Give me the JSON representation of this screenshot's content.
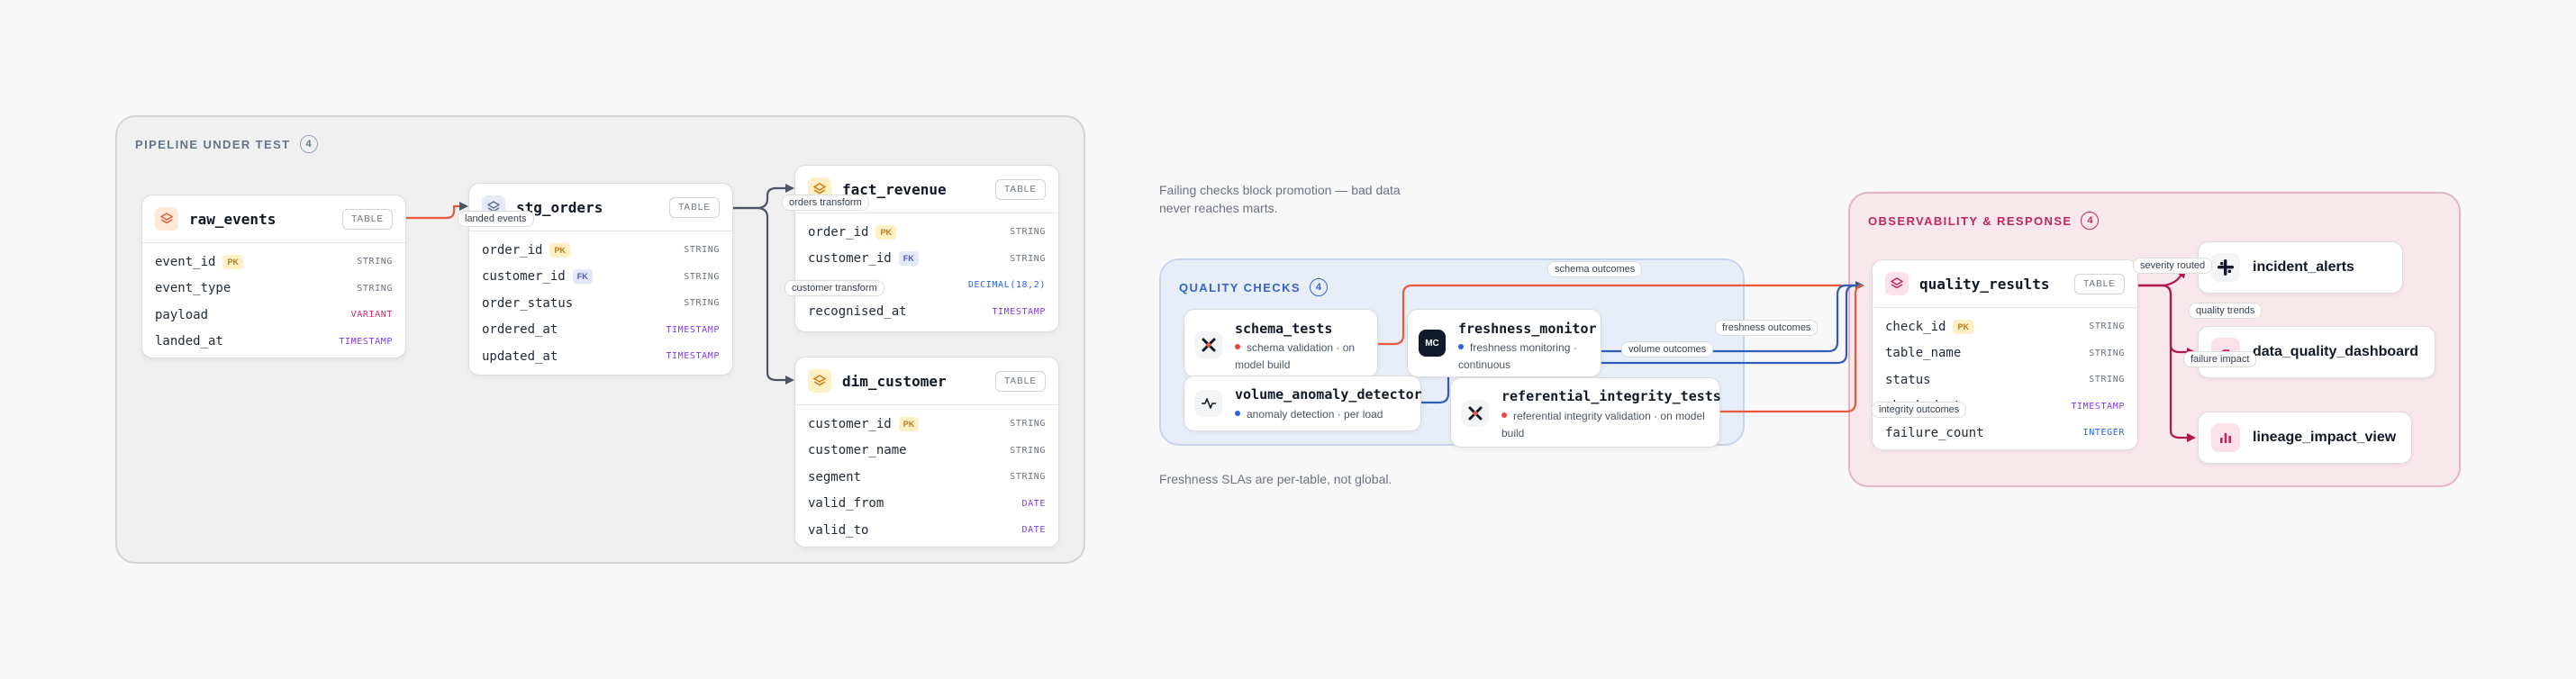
{
  "groups": {
    "pipeline": {
      "title": "PIPELINE UNDER TEST",
      "count": "4"
    },
    "quality_checks": {
      "title": "QUALITY CHECKS",
      "count": "4"
    },
    "observability": {
      "title": "OBSERVABILITY & RESPONSE",
      "count": "4"
    }
  },
  "tables": {
    "raw_events": {
      "name": "raw_events",
      "badge": "TABLE",
      "columns": [
        {
          "name": "event_id",
          "key": "PK",
          "type": "STRING"
        },
        {
          "name": "event_type",
          "key": "",
          "type": "STRING"
        },
        {
          "name": "payload",
          "key": "",
          "type": "VARIANT"
        },
        {
          "name": "landed_at",
          "key": "",
          "type": "TIMESTAMP"
        }
      ]
    },
    "stg_orders": {
      "name": "stg_orders",
      "badge": "TABLE",
      "columns": [
        {
          "name": "order_id",
          "key": "PK",
          "type": "STRING"
        },
        {
          "name": "customer_id",
          "key": "FK",
          "type": "STRING"
        },
        {
          "name": "order_status",
          "key": "",
          "type": "STRING"
        },
        {
          "name": "ordered_at",
          "key": "",
          "type": "TIMESTAMP"
        },
        {
          "name": "updated_at",
          "key": "",
          "type": "TIMESTAMP"
        }
      ]
    },
    "fact_revenue": {
      "name": "fact_revenue",
      "badge": "TABLE",
      "columns": [
        {
          "name": "order_id",
          "key": "PK",
          "type": "STRING"
        },
        {
          "name": "customer_id",
          "key": "FK",
          "type": "STRING"
        },
        {
          "name": "amount",
          "key": "",
          "type": "DECIMAL(18,2)"
        },
        {
          "name": "recognised_at",
          "key": "",
          "type": "TIMESTAMP"
        }
      ]
    },
    "dim_customer": {
      "name": "dim_customer",
      "badge": "TABLE",
      "columns": [
        {
          "name": "customer_id",
          "key": "PK",
          "type": "STRING"
        },
        {
          "name": "customer_name",
          "key": "",
          "type": "STRING"
        },
        {
          "name": "segment",
          "key": "",
          "type": "STRING"
        },
        {
          "name": "valid_from",
          "key": "",
          "type": "DATE"
        },
        {
          "name": "valid_to",
          "key": "",
          "type": "DATE"
        }
      ]
    },
    "quality_results": {
      "name": "quality_results",
      "badge": "TABLE",
      "columns": [
        {
          "name": "check_id",
          "key": "PK",
          "type": "STRING"
        },
        {
          "name": "table_name",
          "key": "",
          "type": "STRING"
        },
        {
          "name": "status",
          "key": "",
          "type": "STRING"
        },
        {
          "name": "checked_at",
          "key": "",
          "type": "TIMESTAMP"
        },
        {
          "name": "failure_count",
          "key": "",
          "type": "INTEGER"
        }
      ]
    }
  },
  "checks": {
    "schema_tests": {
      "title": "schema_tests",
      "subtitle": "schema validation · on model build",
      "dot_color": "#ef4444"
    },
    "freshness_monitor": {
      "title": "freshness_monitor",
      "subtitle": "freshness monitoring · continuous",
      "dot_color": "#2563eb",
      "icon_text": "MC"
    },
    "volume_anomaly_detector": {
      "title": "volume_anomaly_detector",
      "subtitle": "anomaly detection · per load",
      "dot_color": "#2563eb"
    },
    "referential_integrity_tests": {
      "title": "referential_integrity_tests",
      "subtitle": "referential integrity validation · on model build",
      "dot_color": "#ef4444"
    }
  },
  "sinks": {
    "incident_alerts": {
      "name": "incident_alerts",
      "icon": "slack-icon"
    },
    "data_quality_dashboard": {
      "name": "data_quality_dashboard",
      "icon": "dashboard-icon"
    },
    "lineage_impact_view": {
      "name": "lineage_impact_view",
      "icon": "bar-chart-icon"
    }
  },
  "edge_labels": {
    "landed_events": "landed events",
    "orders_transform": "orders transform",
    "customer_transform": "customer transform",
    "schema_outcomes": "schema outcomes",
    "freshness_outcomes": "freshness outcomes",
    "volume_outcomes": "volume outcomes",
    "integrity_outcomes": "integrity outcomes",
    "severity_routed": "severity routed",
    "quality_trends": "quality trends",
    "failure_impact": "failure impact"
  },
  "notes": {
    "top": "Failing checks block promotion — bad data never reaches marts.",
    "bottom": "Freshness SLAs are per-table, not global."
  },
  "colors": {
    "string": "#6b7280",
    "variant": "#db2777",
    "timestamp": "#7c3aed",
    "decimal": "#2563eb",
    "date": "#7c3aed",
    "integer": "#2563eb",
    "edge_pipeline": "#4b5563",
    "edge_red": "#ea5a3a",
    "edge_blue": "#2f5fb8",
    "edge_crimson": "#b0194f"
  }
}
